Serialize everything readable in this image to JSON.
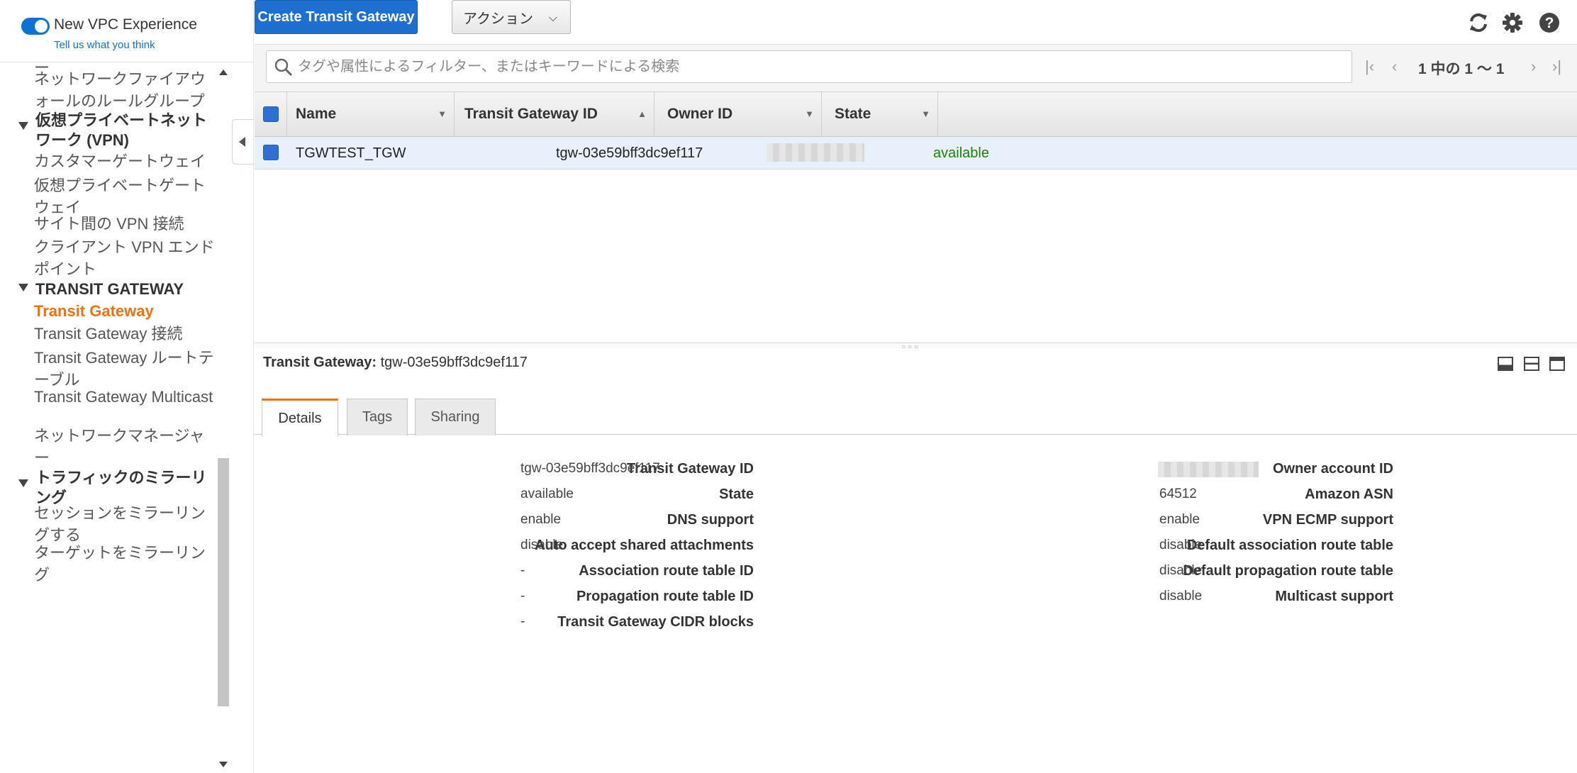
{
  "sidebar": {
    "toggle_title": "New VPC Experience",
    "feedback_link": "Tell us what you think",
    "items": {
      "top_fragment": "ー",
      "firewall_rule_groups": "ネットワークファイアウォールのルールグループ",
      "vpn_section": "仮想プライベートネットワーク (VPN)",
      "customer_gateways": "カスタマーゲートウェイ",
      "virtual_private_gateways": "仮想プライベートゲートウェイ",
      "site_to_site_vpn": "サイト間の VPN 接続",
      "client_vpn_endpoints": "クライアント VPN エンドポイント",
      "transit_section": "TRANSIT GATEWAY",
      "transit_gateway": "Transit Gateway",
      "transit_attachments": "Transit Gateway 接続",
      "transit_route_tables": "Transit Gateway ルートテーブル",
      "transit_multicast": "Transit Gateway Multicast",
      "network_manager": "ネットワークマネージャー",
      "mirroring_section": "トラフィックのミラーリング",
      "mirror_sessions": "セッションをミラーリングする",
      "mirror_targets": "ターゲットをミラーリング"
    }
  },
  "toolbar": {
    "create_label": "Create Transit Gateway",
    "actions_label": "アクション",
    "refresh_icon": "refresh-icon",
    "settings_icon": "gear-icon",
    "help_icon": "help-icon"
  },
  "filter": {
    "placeholder": "タグや属性によるフィルター、またはキーワードによる検索",
    "pager_text": "1 中の 1 ～ 1"
  },
  "table": {
    "headers": [
      "Name",
      "Transit Gateway ID",
      "Owner ID",
      "State"
    ],
    "rows": [
      {
        "name": "TGWTEST_TGW",
        "id": "tgw-03e59bff3dc9ef117",
        "owner": "",
        "state": "available"
      }
    ]
  },
  "detail": {
    "title_label": "Transit Gateway:",
    "title_value": "tgw-03e59bff3dc9ef117",
    "tabs": [
      "Details",
      "Tags",
      "Sharing"
    ],
    "left": [
      {
        "label": "Transit Gateway ID",
        "value": "tgw-03e59bff3dc9ef117"
      },
      {
        "label": "State",
        "value": "available"
      },
      {
        "label": "DNS support",
        "value": "enable"
      },
      {
        "label": "Auto accept shared attachments",
        "value": "disable"
      },
      {
        "label": "Association route table ID",
        "value": "-"
      },
      {
        "label": "Propagation route table ID",
        "value": "-"
      },
      {
        "label": "Transit Gateway CIDR blocks",
        "value": "-"
      }
    ],
    "right": [
      {
        "label": "Owner account ID",
        "value": ""
      },
      {
        "label": "Amazon ASN",
        "value": "64512"
      },
      {
        "label": "VPN ECMP support",
        "value": "enable"
      },
      {
        "label": "Default association route table",
        "value": "disable"
      },
      {
        "label": "Default propagation route table",
        "value": "disable"
      },
      {
        "label": "Multicast support",
        "value": "disable"
      }
    ]
  },
  "colors": {
    "primary_button": "#1f6fd1",
    "active_nav": "#ec7211",
    "status_available": "#1d8102",
    "selected_row": "#e8f1fb"
  }
}
